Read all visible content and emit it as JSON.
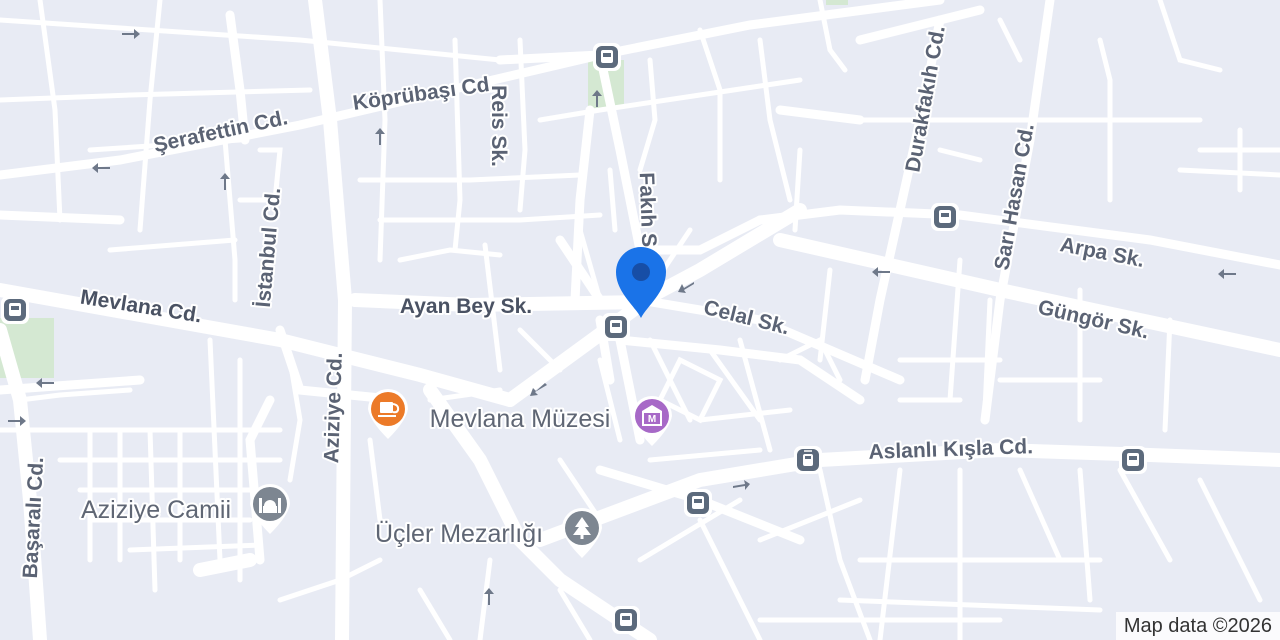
{
  "map": {
    "streets": [
      "Köprübaşı Cd.",
      "Şerafettin Cd.",
      "Reis Sk.",
      "İstanbul Cd.",
      "Mevlana Cd.",
      "Ayan Bey Sk.",
      "Fakıh S",
      "Celal Sk.",
      "Durakfakıh Cd.",
      "Sarı Hasan Cd.",
      "Arpa Sk.",
      "Güngör Sk.",
      "Aziziye Cd.",
      "Aslanlı Kışla Cd.",
      "Başaralı Cd."
    ],
    "pois": [
      {
        "name": "Mevlana Müzesi",
        "icon": "museum-icon",
        "color": "#a769c7"
      },
      {
        "name": "Aziziye Camii",
        "icon": "mosque-icon",
        "color": "#7d8691"
      },
      {
        "name": "Üçler Mezarlığı",
        "icon": "cemetery-icon",
        "color": "#7d8691"
      },
      {
        "name": "",
        "icon": "cafe-icon",
        "color": "#ec7a28"
      }
    ],
    "location_pin": {
      "icon": "location-pin-icon",
      "color": "#1a73e8"
    },
    "transit_icons": [
      "bus-stop-icon",
      "tram-stop-icon"
    ],
    "attribution": "Map data ©2026",
    "colors": {
      "background": "#e8ebf4",
      "road": "#ffffff",
      "park": "#d4e8d2",
      "label": "#5b6374",
      "transit": "#5c6a7c"
    }
  }
}
